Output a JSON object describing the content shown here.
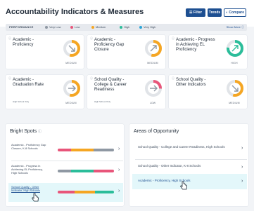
{
  "header": {
    "title": "Accountability Indicators & Measures",
    "filter_label": "Filter",
    "trends_label": "Trends",
    "compare_label": "Compare"
  },
  "legend": {
    "label": "PERFORMANCE",
    "items": [
      {
        "label": "Very Low",
        "color": "#8f98a3"
      },
      {
        "label": "Low",
        "color": "#e8557a"
      },
      {
        "label": "Medium",
        "color": "#f5a623"
      },
      {
        "label": "High",
        "color": "#2bbd9a"
      },
      {
        "label": "Very High",
        "color": "#2aa5d9"
      }
    ],
    "show_more": "Show More"
  },
  "cards": [
    {
      "title": "Academic - Proficiency",
      "subtitle": "",
      "level": "MEDIUM",
      "icon": "arrow-right-down-icon"
    },
    {
      "title": "Academic - Proficiency Gap Closure",
      "subtitle": "",
      "level": "MEDIUM",
      "icon": "arrow-up-right-icon"
    },
    {
      "title": "Academic - Progress in Achieving EL Proficiency",
      "subtitle": "",
      "level": "HIGH",
      "icon": "arrow-up-right-icon"
    },
    {
      "title": "Academic - Graduation Rate",
      "subtitle": "High School Only",
      "level": "MEDIUM",
      "icon": "arrow-right-icon"
    },
    {
      "title": "School Quality - College & Career Readiness",
      "subtitle": "High School Only",
      "level": "LOW",
      "icon": "arrow-right-icon"
    },
    {
      "title": "School Quality - Other Indicators",
      "subtitle": "",
      "level": "MEDIUM",
      "icon": "arrow-right-down-icon"
    }
  ],
  "bright_spots": {
    "title": "Bright Spots",
    "items": [
      {
        "label": "Academic - Proficiency Gap Closure, K-8 Schools",
        "active": false
      },
      {
        "label": "Academic - Progress in Achieving EL Proficiency, High Schools",
        "active": false
      },
      {
        "label": "School Quality - Other Indicator, High Schools",
        "active": true
      }
    ]
  },
  "opportunity": {
    "title": "Areas of Opportunity",
    "items": [
      {
        "label": "School Quality - College and Career Readiness, High Schools",
        "active": false
      },
      {
        "label": "School Quality - Other Indicator, K-8 Schools",
        "active": false
      },
      {
        "label": "Academic - Proficiency, High Schools",
        "active": true
      }
    ]
  },
  "colors": {
    "brand": "#1d4f91",
    "medium": "#f5a623",
    "high": "#2bbd9a",
    "low": "#e8557a",
    "very_low": "#8f98a3",
    "very_high": "#2aa5d9",
    "highlight": "#e3f7fa"
  }
}
